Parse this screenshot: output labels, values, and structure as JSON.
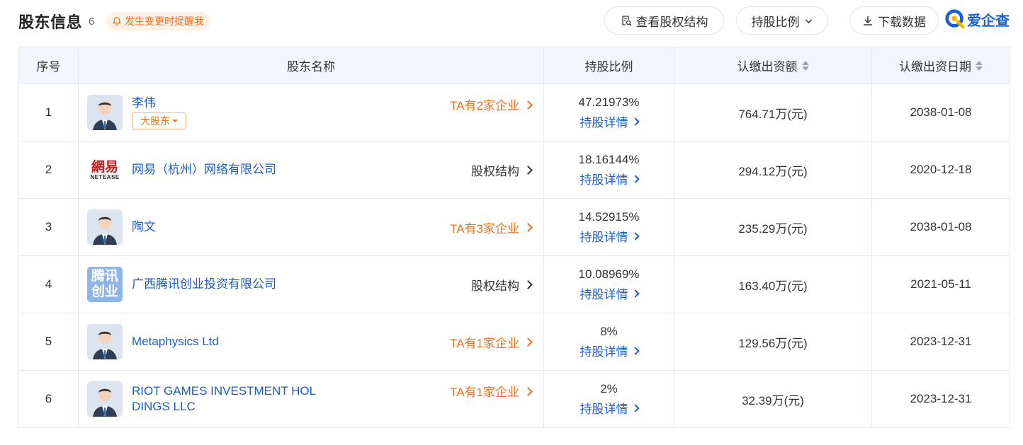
{
  "header": {
    "title": "股东信息",
    "count": "6",
    "remind_label": "发生变更时提醒我",
    "struct_button": "查看股权结构",
    "ratio_button": "持股比例",
    "download_button": "下载数据",
    "brand": "爱企查"
  },
  "columns": {
    "index": "序号",
    "name": "股东名称",
    "ratio": "持股比例",
    "amount": "认缴出资额",
    "date": "认缴出资日期"
  },
  "rows": [
    {
      "index": "1",
      "name": "李伟",
      "tag": "大股东",
      "link": "TA有2家企业",
      "ratio": "47.21973%",
      "detail": "持股详情",
      "amount": "764.71万(元)",
      "date": "2038-01-08"
    },
    {
      "index": "2",
      "name": "网易（杭州）网络有限公司",
      "link": "股权结构",
      "ratio": "18.16144%",
      "detail": "持股详情",
      "amount": "294.12万(元)",
      "date": "2020-12-18",
      "logo_text_top": "網易",
      "logo_text_bottom": "NETEASE"
    },
    {
      "index": "3",
      "name": "陶文",
      "link": "TA有3家企业",
      "ratio": "14.52915%",
      "detail": "持股详情",
      "amount": "235.29万(元)",
      "date": "2038-01-08"
    },
    {
      "index": "4",
      "name": "广西腾讯创业投资有限公司",
      "link": "股权结构",
      "ratio": "10.08969%",
      "detail": "持股详情",
      "amount": "163.40万(元)",
      "date": "2021-05-11",
      "logo_text_top": "腾讯",
      "logo_text_bottom": "创业"
    },
    {
      "index": "5",
      "name": "Metaphysics Ltd",
      "link": "TA有1家企业",
      "ratio": "8%",
      "detail": "持股详情",
      "amount": "129.56万(元)",
      "date": "2023-12-31"
    },
    {
      "index": "6",
      "name": "RIOT GAMES INVESTMENT HOLDINGS LLC",
      "name_line1": "RIOT GAMES INVESTMENT HOL",
      "name_line2": "DINGS LLC",
      "link": "TA有1家企业",
      "ratio": "2%",
      "detail": "持股详情",
      "amount": "32.39万(元)",
      "date": "2023-12-31"
    }
  ],
  "colors": {
    "link_blue": "#1a5cd1",
    "accent_orange": "#f26f21",
    "header_bg": "#f3f6fc",
    "border": "#e4e9f2"
  }
}
